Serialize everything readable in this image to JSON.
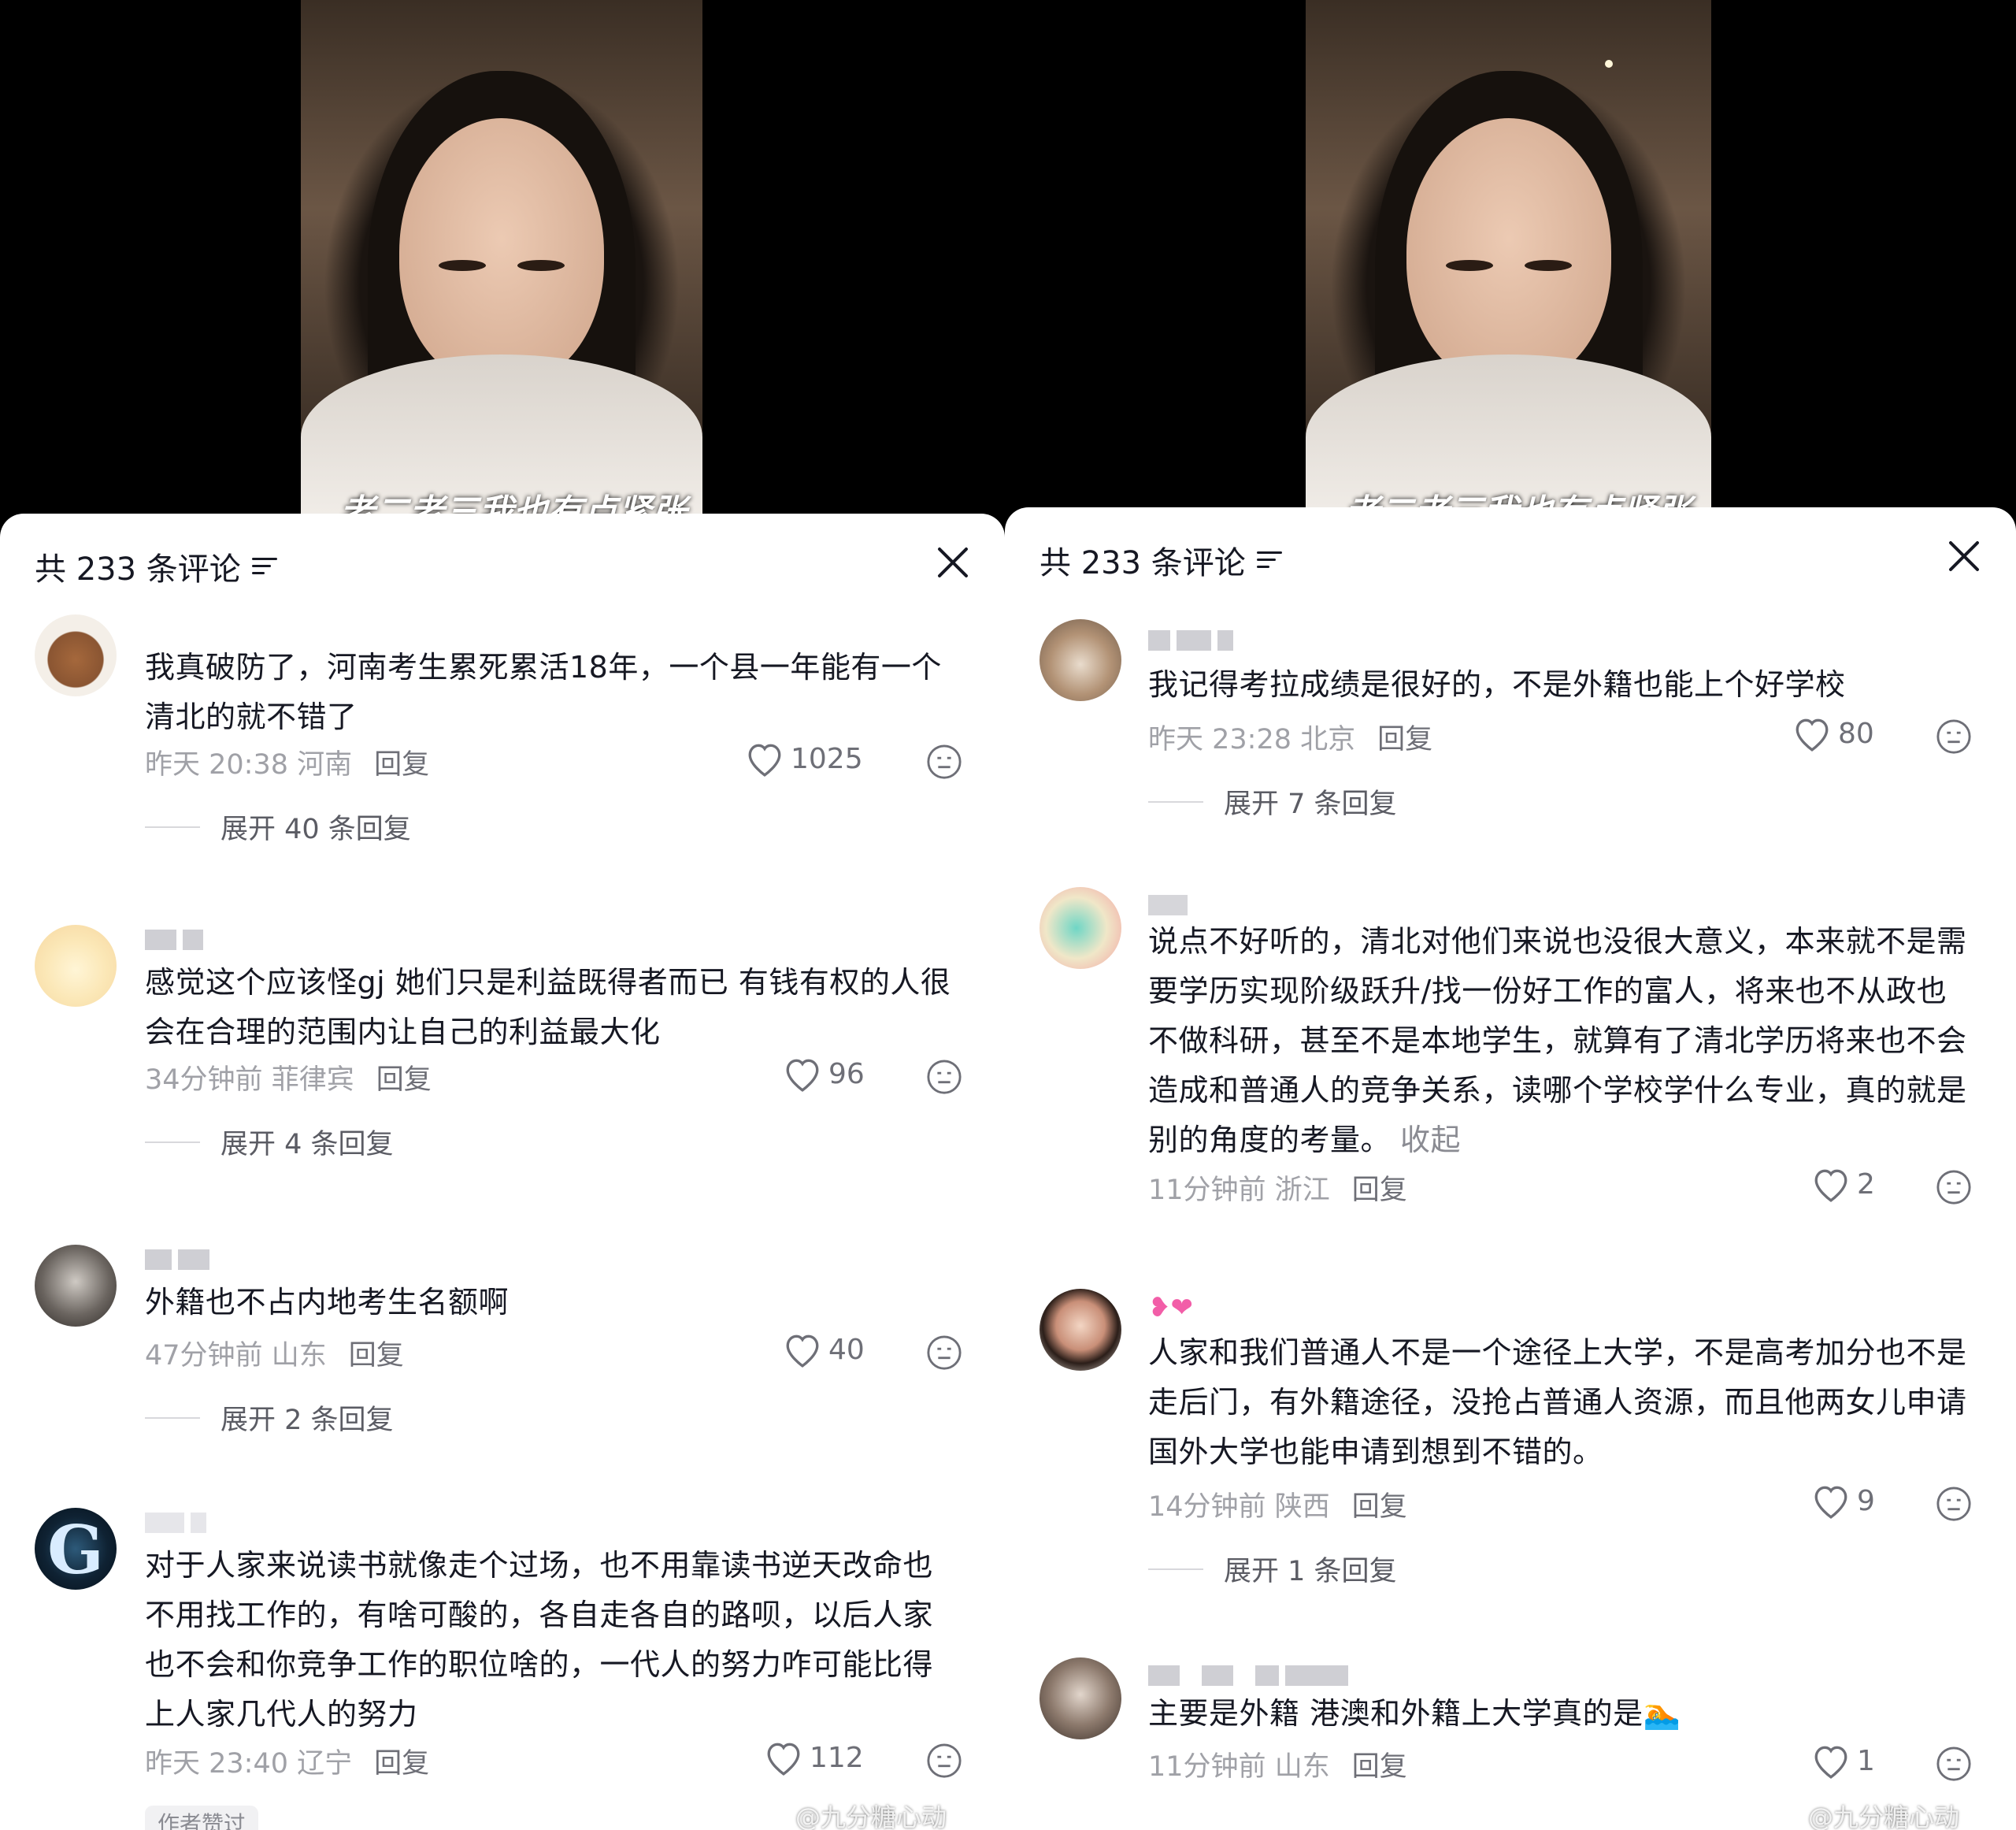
{
  "video": {
    "caption": "老二老三我也有点紧张"
  },
  "comments_header": {
    "title": "共 233 条评论",
    "sort_icon": "sort-filter-icon",
    "close_icon": "close-icon"
  },
  "left_panel": {
    "comments": [
      {
        "text": "我真破防了，河南考生累死累活18年，一个县一年能有一个清北的就不错了",
        "time": "昨天 20:38",
        "location": "河南",
        "reply": "回复",
        "likes": "1025",
        "expand": "展开 40 条回复"
      },
      {
        "text": "感觉这个应该怪gj 她们只是利益既得者而已 有钱有权的人很会在合理的范围内让自己的利益最大化",
        "time": "34分钟前",
        "location": "菲律宾",
        "reply": "回复",
        "likes": "96",
        "expand": "展开 4 条回复"
      },
      {
        "text": "外籍也不占内地考生名额啊",
        "time": "47分钟前",
        "location": "山东",
        "reply": "回复",
        "likes": "40",
        "expand": "展开 2 条回复"
      },
      {
        "text": "对于人家来说读书就像走个过场，也不用靠读书逆天改命也不用找工作的，有啥可酸的，各自走各自的路呗，以后人家也不会和你竞争工作的职位啥的，一代人的努力咋可能比得上人家几代人的努力",
        "time": "昨天 23:40",
        "location": "辽宁",
        "reply": "回复",
        "likes": "112",
        "tag": "作者赞过"
      }
    ]
  },
  "right_panel": {
    "comments": [
      {
        "text": "我记得考拉成绩是很好的，不是外籍也能上个好学校",
        "time": "昨天 23:28",
        "location": "北京",
        "reply": "回复",
        "likes": "80",
        "expand": "展开 7 条回复"
      },
      {
        "text": "说点不好听的，清北对他们来说也没很大意义，本来就不是需要学历实现阶级跃升/找一份好工作的富人，将来也不从政也不做科研，甚至不是本地学生，就算有了清北学历将来也不会造成和普通人的竞争关系，读哪个学校学什么专业，真的就是别的角度的考量。",
        "collapse": "收起",
        "time": "11分钟前",
        "location": "浙江",
        "reply": "回复",
        "likes": "2"
      },
      {
        "text": "人家和我们普通人不是一个途径上大学，不是高考加分也不是走后门，有外籍途径，没抢占普通人资源，而且他两女儿申请国外大学也能申请到想到不错的。",
        "time": "14分钟前",
        "location": "陕西",
        "reply": "回复",
        "likes": "9",
        "expand": "展开 1 条回复"
      },
      {
        "text": "主要是外籍 港澳和外籍上大学真的是",
        "emoji": "🏊",
        "time": "11分钟前",
        "location": "山东",
        "reply": "回复",
        "likes": "1"
      }
    ]
  },
  "watermark": "@九分糖心动"
}
